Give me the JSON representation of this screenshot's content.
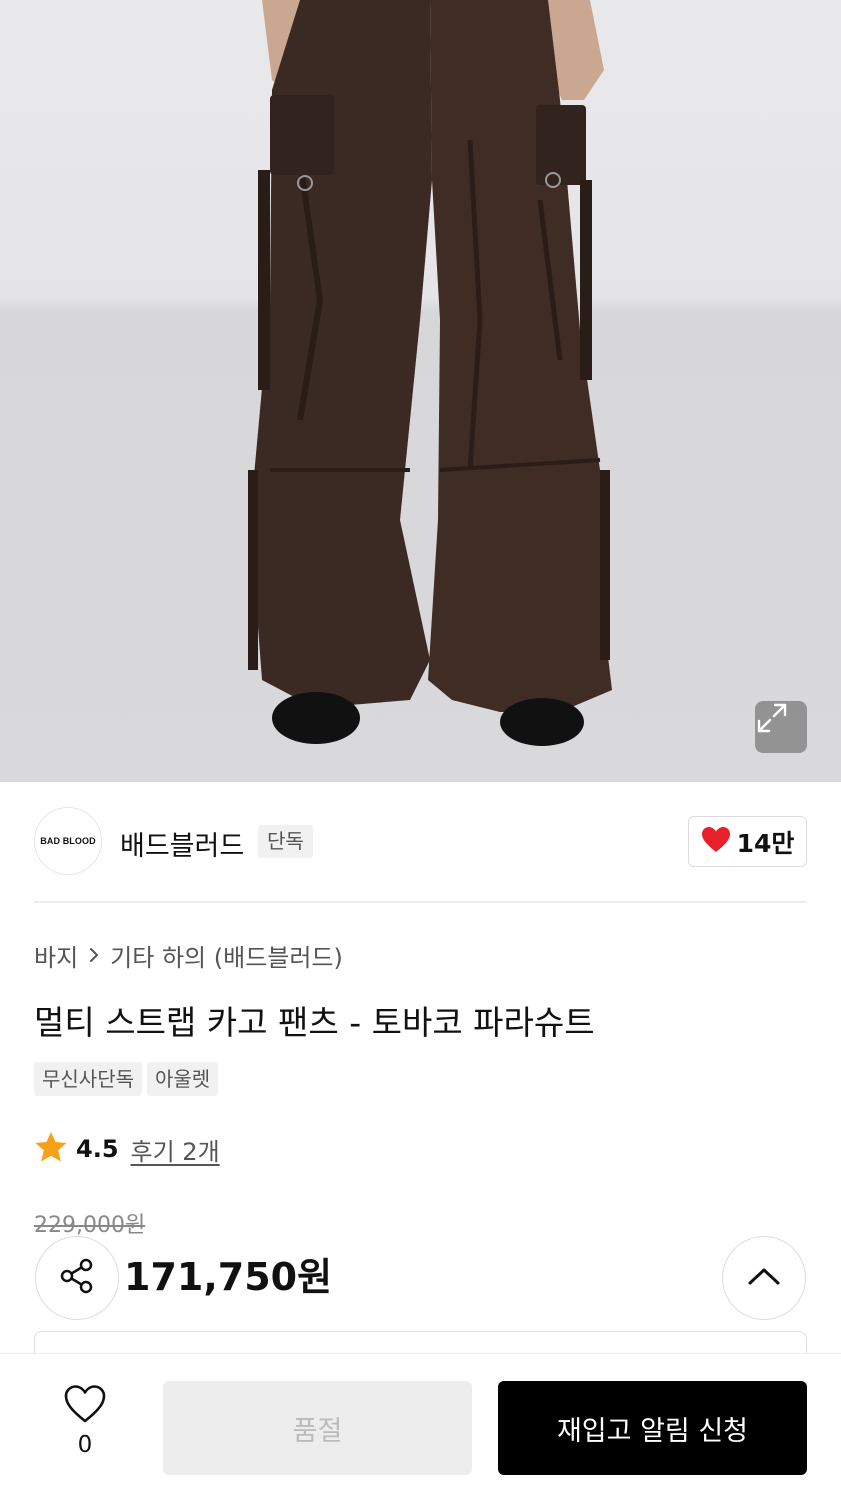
{
  "product_image": {
    "alt": "",
    "expand_icon": "expand-icon"
  },
  "brand": {
    "logo_text": "BAD BLOOD",
    "name": "배드블러드",
    "tag": "단독",
    "like_count": "14만",
    "like_icon": "heart-filled-icon",
    "like_color": "#e8202a"
  },
  "breadcrumb": {
    "items": [
      "바지",
      "기타 하의 (배드블러드)"
    ],
    "separator_icon": "chevron-right-icon"
  },
  "product": {
    "title": "멀티 스트랩 카고 팬츠 - 토바코 파라슈트",
    "chips": [
      "무신사단독",
      "아울렛"
    ]
  },
  "rating": {
    "score": "4.5",
    "review_link": "후기 2개",
    "star_color": "#f7a11a"
  },
  "price": {
    "original": "229,000원",
    "sale": "171,750원"
  },
  "actions": {
    "share_icon": "share-icon",
    "top_icon": "chevron-up-icon"
  },
  "bottom_bar": {
    "wish_icon": "heart-outline-icon",
    "wish_count": "0",
    "soldout_label": "품절",
    "restock_label": "재입고 알림 신청"
  }
}
